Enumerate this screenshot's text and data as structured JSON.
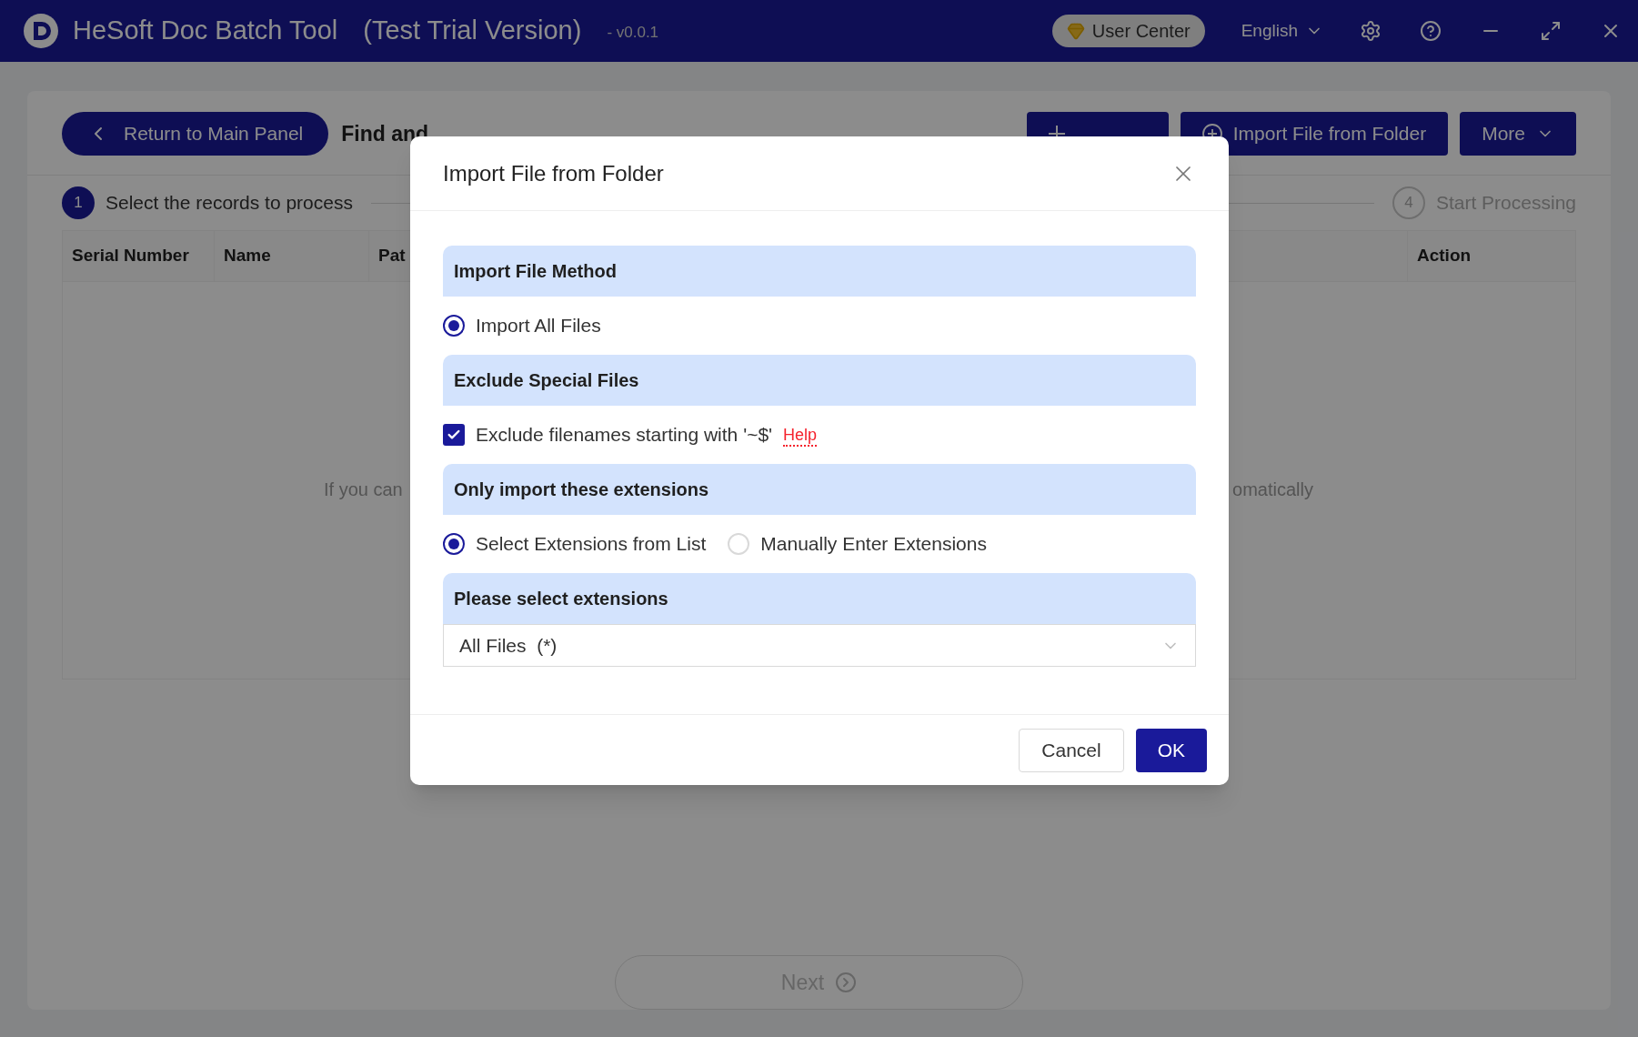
{
  "window": {
    "title": "HeSoft Doc Batch Tool",
    "edition": "(Test Trial Version)",
    "version": "- v0.0.1",
    "user_center": "User Center",
    "language": "English"
  },
  "toolbar": {
    "back_button": "Return to Main Panel",
    "page_title": "Find and",
    "buttons": [
      {
        "kind": "add"
      },
      {
        "label": "Import File from Folder",
        "kind": "import"
      },
      {
        "label": "More",
        "kind": "menu"
      }
    ]
  },
  "steps": [
    {
      "number": "1",
      "label": "Select the records to process",
      "selected": true
    },
    {
      "number": "4",
      "label": "Start Processing",
      "selected": false
    }
  ],
  "table": {
    "columns": [
      "Serial Number",
      "Name",
      "Pat",
      "Action"
    ],
    "empty_hint_start": "If you can",
    "empty_hint_end": "omatically"
  },
  "next_button": "Next",
  "dialog": {
    "title": "Import File from Folder",
    "sections": [
      {
        "heading": "Import File Method",
        "kind": "radio",
        "options": [
          {
            "label": "Import All Files",
            "selected": true
          }
        ]
      },
      {
        "heading": "Exclude Special Files",
        "kind": "checkbox",
        "options": [
          {
            "label": "Exclude filenames starting with '~$'",
            "checked": true,
            "link": "Help"
          }
        ]
      },
      {
        "heading": "Only import these extensions",
        "kind": "radio",
        "options": [
          {
            "label": "Select Extensions from List",
            "selected": true
          },
          {
            "label": "Manually Enter Extensions",
            "selected": false
          }
        ]
      },
      {
        "heading": "Please select extensions",
        "kind": "select",
        "value": "All Files  (*)"
      }
    ],
    "buttons": [
      {
        "label": "Cancel",
        "kind": "secondary"
      },
      {
        "label": "OK",
        "kind": "primary"
      }
    ]
  }
}
